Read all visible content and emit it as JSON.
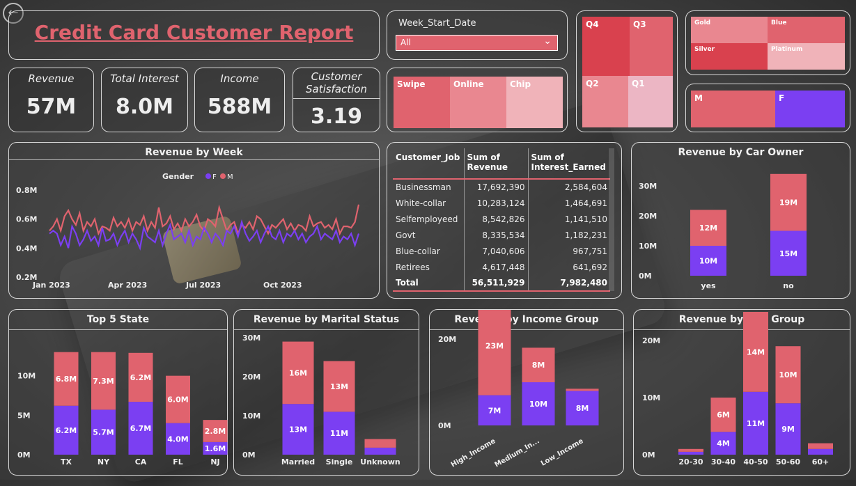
{
  "title": "Credit Card Customer Report",
  "kpis": [
    {
      "label": "Revenue",
      "value": "57M"
    },
    {
      "label": "Total Interest",
      "value": "8.0M"
    },
    {
      "label": "Income",
      "value": "588M"
    },
    {
      "label": "Customer Satisfaction",
      "value": "3.19"
    }
  ],
  "slicer": {
    "label": "Week_Start_Date",
    "value": "All"
  },
  "card_type": [
    "Swipe",
    "Online",
    "Chip"
  ],
  "quarters": [
    "Q4",
    "Q3",
    "Q2",
    "Q1"
  ],
  "card_category": [
    "Gold",
    "Blue",
    "Silver",
    "Platinum"
  ],
  "gender_tiles": [
    "M",
    "F"
  ],
  "colors": {
    "female": "#7b3ff2",
    "male": "#e0636e"
  },
  "revenue_by_week": {
    "title": "Revenue by Week",
    "legend_title": "Gender",
    "legend": [
      "F",
      "M"
    ],
    "yticks": [
      "0.8M",
      "0.6M",
      "0.4M",
      "0.2M"
    ],
    "xticks": [
      "Jan 2023",
      "Apr 2023",
      "Jul 2023",
      "Oct 2023"
    ]
  },
  "job_table": {
    "headers": [
      "Customer_Job",
      "Sum of Revenue",
      "Sum of Interest_Earned"
    ],
    "rows": [
      [
        "Businessman",
        "17,692,390",
        "2,584,604"
      ],
      [
        "White-collar",
        "10,283,124",
        "1,464,691"
      ],
      [
        "Selfemployeed",
        "8,542,826",
        "1,141,510"
      ],
      [
        "Govt",
        "8,335,534",
        "1,182,231"
      ],
      [
        "Blue-collar",
        "7,040,606",
        "967,751"
      ],
      [
        "Retirees",
        "4,617,448",
        "641,692"
      ]
    ],
    "total": [
      "Total",
      "56,511,929",
      "7,982,480"
    ]
  },
  "chart_data": [
    {
      "type": "line",
      "title": "Revenue by Week",
      "legend_title": "Gender",
      "yticks": [
        "0.8M",
        "0.6M",
        "0.4M",
        "0.2M"
      ],
      "ylim": [
        0.2,
        0.8
      ],
      "xticks": [
        "Jan 2023",
        "Apr 2023",
        "Jul 2023",
        "Oct 2023"
      ],
      "series": [
        {
          "name": "M",
          "values": [
            0.52,
            0.55,
            0.6,
            0.52,
            0.62,
            0.66,
            0.6,
            0.56,
            0.64,
            0.52,
            0.58,
            0.55,
            0.6,
            0.5,
            0.55,
            0.54,
            0.52,
            0.61,
            0.55,
            0.58,
            0.54,
            0.6,
            0.52,
            0.58,
            0.56,
            0.62,
            0.52,
            0.58,
            0.54,
            0.68,
            0.55,
            0.57,
            0.62,
            0.53,
            0.57,
            0.52,
            0.6,
            0.55,
            0.58,
            0.63,
            0.55,
            0.52,
            0.6,
            0.58,
            0.55,
            0.68,
            0.6,
            0.52,
            0.56,
            0.58,
            0.5,
            0.56,
            0.54,
            0.58,
            0.53,
            0.62,
            0.6,
            0.55,
            0.5,
            0.56,
            0.54,
            0.57,
            0.6,
            0.53,
            0.57,
            0.52,
            0.56,
            0.55,
            0.52,
            0.62,
            0.55,
            0.57,
            0.58,
            0.54,
            0.56,
            0.53,
            0.6,
            0.5,
            0.55,
            0.55,
            0.54,
            0.58,
            0.7
          ]
        },
        {
          "name": "F",
          "values": [
            0.5,
            0.52,
            0.5,
            0.42,
            0.48,
            0.4,
            0.55,
            0.5,
            0.42,
            0.46,
            0.52,
            0.45,
            0.48,
            0.42,
            0.54,
            0.45,
            0.46,
            0.5,
            0.42,
            0.48,
            0.52,
            0.44,
            0.5,
            0.46,
            0.4,
            0.54,
            0.48,
            0.46,
            0.44,
            0.52,
            0.42,
            0.5,
            0.56,
            0.46,
            0.48,
            0.5,
            0.44,
            0.52,
            0.42,
            0.48,
            0.46,
            0.54,
            0.5,
            0.44,
            0.5,
            0.47,
            0.42,
            0.52,
            0.5,
            0.55,
            0.48,
            0.58,
            0.5,
            0.45,
            0.48,
            0.52,
            0.44,
            0.5,
            0.55,
            0.48,
            0.46,
            0.52,
            0.44,
            0.5,
            0.48,
            0.52,
            0.46,
            0.5,
            0.44,
            0.48,
            0.5,
            0.55,
            0.46,
            0.5,
            0.48,
            0.46,
            0.52,
            0.44,
            0.48,
            0.46,
            0.5,
            0.42,
            0.5
          ]
        }
      ]
    },
    {
      "type": "bar",
      "stacked": true,
      "title": "Revenue by Car Owner",
      "categories": [
        "yes",
        "no"
      ],
      "yticks": [
        "30M",
        "20M",
        "10M",
        "0M"
      ],
      "ylim": [
        0,
        30
      ],
      "series": [
        {
          "name": "F",
          "values": [
            10,
            15
          ],
          "labels": [
            "10M",
            "15M"
          ]
        },
        {
          "name": "M",
          "values": [
            12,
            19
          ],
          "labels": [
            "12M",
            "19M"
          ]
        }
      ]
    },
    {
      "type": "bar",
      "stacked": true,
      "title": "Top 5 State",
      "categories": [
        "TX",
        "NY",
        "CA",
        "FL",
        "NJ"
      ],
      "yticks": [
        "10M",
        "5M",
        "0M"
      ],
      "ylim": [
        0,
        13.5
      ],
      "series": [
        {
          "name": "F",
          "values": [
            6.2,
            5.7,
            6.7,
            4.0,
            1.6
          ],
          "labels": [
            "6.2M",
            "5.7M",
            "6.7M",
            "4.0M",
            "1.6M"
          ]
        },
        {
          "name": "M",
          "values": [
            6.8,
            7.3,
            6.2,
            6.0,
            2.8
          ],
          "labels": [
            "6.8M",
            "7.3M",
            "6.2M",
            "6.0M",
            "2.8M"
          ]
        }
      ]
    },
    {
      "type": "bar",
      "stacked": true,
      "title": "Revenue by Marital Status",
      "categories": [
        "Married",
        "Single",
        "Unknown"
      ],
      "yticks": [
        "30M",
        "20M",
        "10M",
        "0M"
      ],
      "ylim": [
        0,
        30
      ],
      "series": [
        {
          "name": "F",
          "values": [
            13,
            11,
            1.8
          ],
          "labels": [
            "13M",
            "11M",
            ""
          ]
        },
        {
          "name": "M",
          "values": [
            16,
            13,
            2.2
          ],
          "labels": [
            "16M",
            "13M",
            ""
          ]
        }
      ]
    },
    {
      "type": "bar",
      "stacked": true,
      "title": "Revenue by Income Group",
      "categories": [
        "High_Income",
        "Medium_In...",
        "Low_Income"
      ],
      "yticks": [
        "20M",
        "0M"
      ],
      "ylim": [
        0,
        20
      ],
      "series": [
        {
          "name": "F",
          "values": [
            7,
            10,
            8
          ],
          "labels": [
            "7M",
            "10M",
            "8M"
          ]
        },
        {
          "name": "M",
          "values": [
            23,
            8,
            0.5
          ],
          "labels": [
            "23M",
            "8M",
            ""
          ]
        }
      ]
    },
    {
      "type": "bar",
      "stacked": true,
      "title": "Revenue by Age Group",
      "categories": [
        "20-30",
        "30-40",
        "40-50",
        "50-60",
        "60+"
      ],
      "yticks": [
        "20M",
        "10M",
        "0M"
      ],
      "ylim": [
        0,
        20
      ],
      "series": [
        {
          "name": "F",
          "values": [
            0.5,
            4,
            11,
            9,
            1
          ],
          "labels": [
            "",
            "4M",
            "11M",
            "9M",
            ""
          ]
        },
        {
          "name": "M",
          "values": [
            0.5,
            6,
            14,
            10,
            1
          ],
          "labels": [
            "",
            "6M",
            "14M",
            "10M",
            ""
          ]
        }
      ]
    }
  ]
}
